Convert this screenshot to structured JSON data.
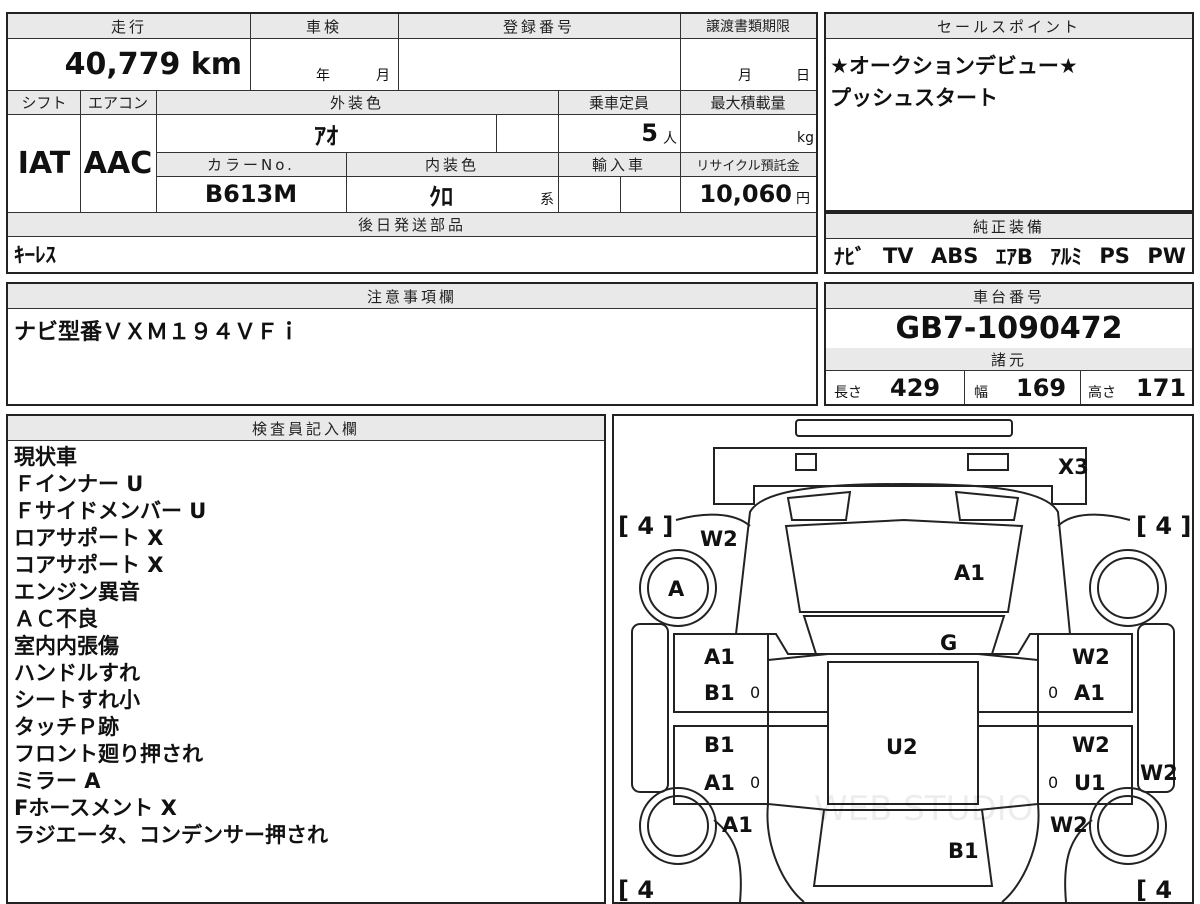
{
  "vehicle": {
    "mileage_label": "走行",
    "mileage": "40,779 km",
    "inspection_label": "車検",
    "inspection_year": "年",
    "inspection_month": "月",
    "registration_label": "登録番号",
    "transfer_label": "譲渡書類期限",
    "transfer_month": "月",
    "transfer_day": "日",
    "shift_label": "シフト",
    "shift": "IAT",
    "aircon_label": "エアコン",
    "aircon": "AAC",
    "exterior_color_label": "外装色",
    "exterior_color": "ｱｵ",
    "capacity_label": "乗車定員",
    "capacity": "5",
    "capacity_unit": "人",
    "max_load_label": "最大積載量",
    "max_load_unit": "kg",
    "color_no_label": "カラーNo.",
    "color_no": "B613M",
    "interior_color_label": "内装色",
    "interior_color": "ｸﾛ",
    "interior_suffix": "系",
    "import_label": "輸入車",
    "recycle_label": "リサイクル預託金",
    "recycle_fee": "10,060",
    "recycle_unit": "円",
    "later_parts_label": "後日発送部品",
    "later_parts": "ｷｰﾚｽ"
  },
  "sales_points": {
    "label": "セールスポイント",
    "lines": [
      "★オークションデビュー★",
      "プッシュスタート"
    ]
  },
  "equipment": {
    "label": "純正装備",
    "items": [
      "ﾅﾋﾞ",
      "TV",
      "ABS",
      "ｴｱB",
      "ｱﾙﾐ",
      "PS",
      "PW"
    ]
  },
  "notes": {
    "label": "注意事項欄",
    "text": "ナビ型番ＶＸＭ１９４ＶＦｉ"
  },
  "chassis": {
    "label": "車台番号",
    "number": "GB7-1090472",
    "specs_label": "諸元",
    "length_label": "長さ",
    "length": "429",
    "width_label": "幅",
    "width": "169",
    "height_label": "高さ",
    "height": "171"
  },
  "inspector": {
    "label": "検査員記入欄",
    "lines": [
      "現状車",
      "Ｆインナー U",
      "Ｆサイドメンバー U",
      "ロアサポート X",
      "コアサポート X",
      "エンジン異音",
      "ＡＣ不良",
      "室内内張傷",
      "ハンドルすれ",
      "シートすれ小",
      "タッチＰ跡",
      "フロント廻り押され",
      "ミラー A",
      "Fホースメント X",
      "ラジエータ、コンデンサー押され"
    ]
  },
  "diagram": {
    "tire_tl": "[ 4 ]",
    "tire_tr": "[ 4 ]",
    "tire_bl": "[ 4",
    "tire_br": "[ 4",
    "marks": {
      "bumper": "X3",
      "fender_l": "W2",
      "tire_a": "A",
      "hood": "A1",
      "windshield": "G",
      "door_fl_1": "A1",
      "door_fl_2": "B1",
      "door_fl_zero": "0",
      "door_fr_1": "W2",
      "door_fr_zero": "0",
      "door_fr_2": "A1",
      "door_rl_1": "B1",
      "door_rl_2": "A1",
      "door_rl_zero": "0",
      "door_rr_1": "W2",
      "door_rr_zero": "0",
      "door_rr_2": "U1",
      "side_r": "W2",
      "roof": "U2",
      "rear_l": "A1",
      "rear_r": "W2",
      "trunk": "B1"
    },
    "watermark": "WEB STUDIO"
  }
}
